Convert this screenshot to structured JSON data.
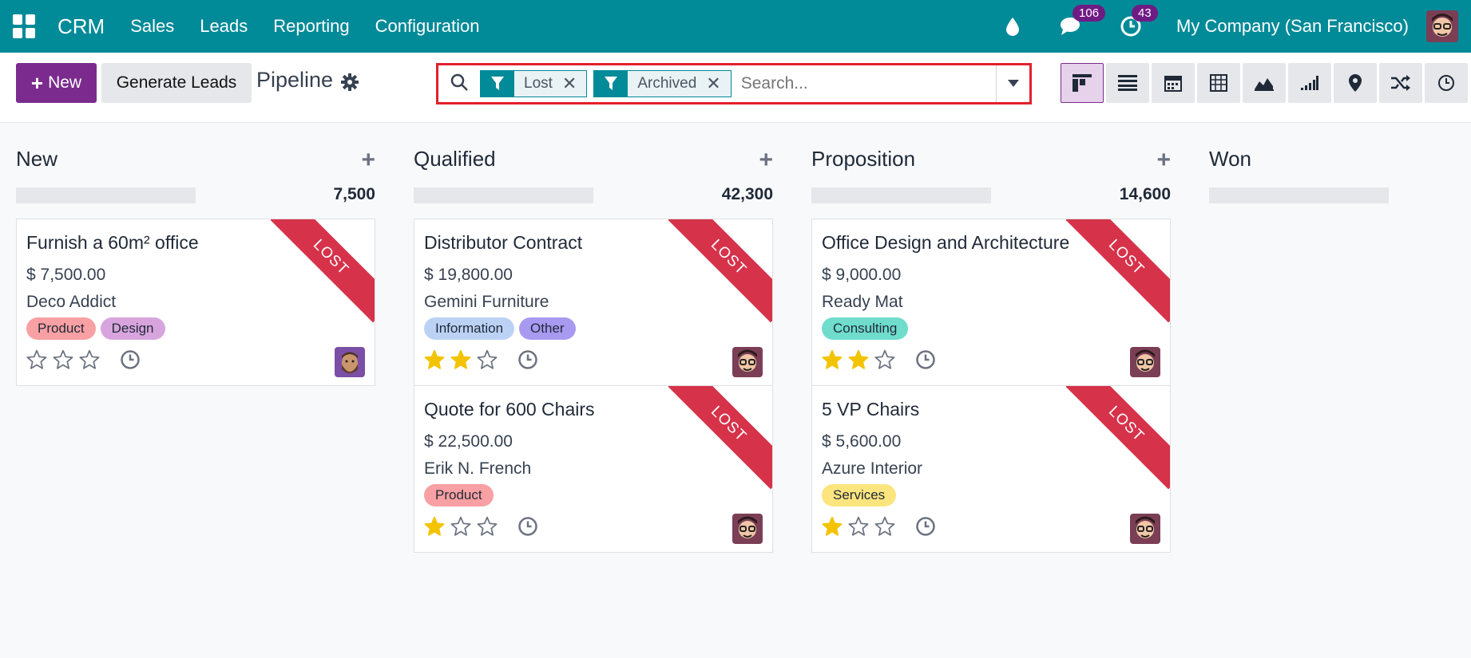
{
  "navbar": {
    "brand": "CRM",
    "menu": [
      "Sales",
      "Leads",
      "Reporting",
      "Configuration"
    ],
    "messages_count": "106",
    "activities_count": "43",
    "company": "My Company (San Francisco)"
  },
  "control": {
    "new_label": "New",
    "generate_label": "Generate Leads",
    "title": "Pipeline",
    "facets": [
      "Lost",
      "Archived"
    ],
    "search_placeholder": "Search..."
  },
  "views": [
    "kanban-icon",
    "list-icon",
    "calendar-icon",
    "pivot-icon",
    "graph-icon",
    "cohort-icon",
    "map-icon",
    "shuffle-icon",
    "activity-icon"
  ],
  "colors": {
    "brand": "#018a98",
    "primary": "#7b2b8e",
    "ribbon": "#d6324a",
    "highlight": "#e41f2b"
  },
  "columns": [
    {
      "title": "New",
      "total": "7,500",
      "cards": [
        {
          "name": "Furnish a 60m² office",
          "amount": "$ 7,500.00",
          "partner": "Deco Addict",
          "tags": [
            {
              "label": "Product",
              "color": "#f8a0a3"
            },
            {
              "label": "Design",
              "color": "#d8a4de"
            }
          ],
          "stars": 0,
          "ribbon": "LOST",
          "avatar": "bearded"
        }
      ]
    },
    {
      "title": "Qualified",
      "total": "42,300",
      "cards": [
        {
          "name": "Distributor Contract",
          "amount": "$ 19,800.00",
          "partner": "Gemini Furniture",
          "tags": [
            {
              "label": "Information",
              "color": "#bcd2f5"
            },
            {
              "label": "Other",
              "color": "#a79af0"
            }
          ],
          "stars": 2,
          "ribbon": "LOST",
          "avatar": "glasses"
        },
        {
          "name": "Quote for 600 Chairs",
          "amount": "$ 22,500.00",
          "partner": "Erik N. French",
          "tags": [
            {
              "label": "Product",
              "color": "#f8a0a3"
            }
          ],
          "stars": 1,
          "ribbon": "LOST",
          "avatar": "glasses"
        }
      ]
    },
    {
      "title": "Proposition",
      "total": "14,600",
      "cards": [
        {
          "name": "Office Design and Architecture",
          "amount": "$ 9,000.00",
          "partner": "Ready Mat",
          "tags": [
            {
              "label": "Consulting",
              "color": "#6fdccc"
            }
          ],
          "stars": 2,
          "ribbon": "LOST",
          "avatar": "glasses"
        },
        {
          "name": "5 VP Chairs",
          "amount": "$ 5,600.00",
          "partner": "Azure Interior",
          "tags": [
            {
              "label": "Services",
              "color": "#fce57e"
            }
          ],
          "stars": 1,
          "ribbon": "LOST",
          "avatar": "glasses"
        }
      ]
    },
    {
      "title": "Won",
      "total": "",
      "cards": []
    }
  ]
}
